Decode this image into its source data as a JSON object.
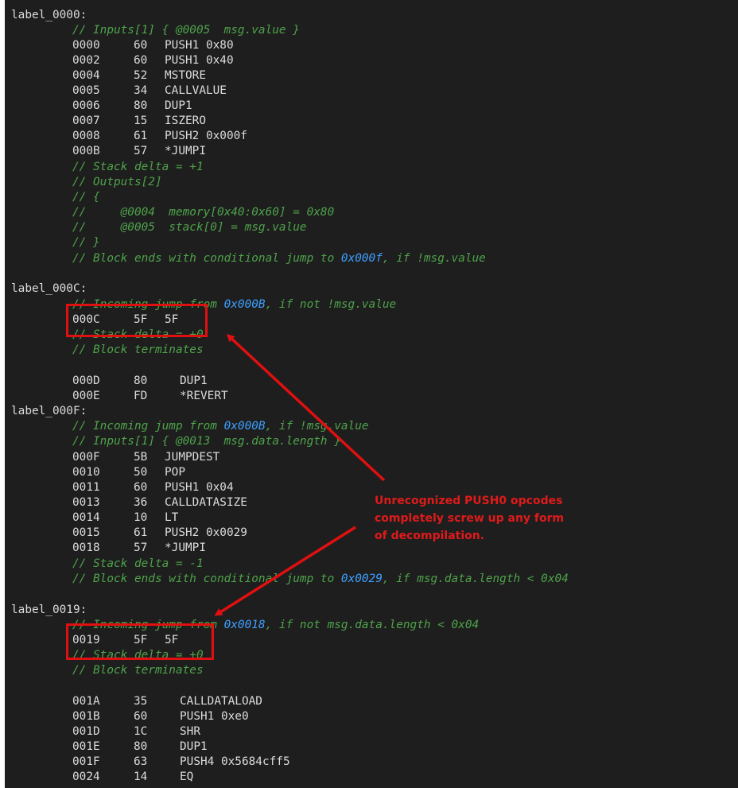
{
  "blocks": [
    {
      "label": "label_0000:",
      "pre_comments": [
        "// Inputs[1] { @0005  msg.value }"
      ],
      "instructions": [
        {
          "addr": "0000",
          "op": "60",
          "mnemonic": "PUSH1 0x80"
        },
        {
          "addr": "0002",
          "op": "60",
          "mnemonic": "PUSH1 0x40"
        },
        {
          "addr": "0004",
          "op": "52",
          "mnemonic": "MSTORE"
        },
        {
          "addr": "0005",
          "op": "34",
          "mnemonic": "CALLVALUE"
        },
        {
          "addr": "0006",
          "op": "80",
          "mnemonic": "DUP1"
        },
        {
          "addr": "0007",
          "op": "15",
          "mnemonic": "ISZERO"
        },
        {
          "addr": "0008",
          "op": "61",
          "mnemonic": "PUSH2 0x000f"
        },
        {
          "addr": "000B",
          "op": "57",
          "mnemonic": "*JUMPI"
        }
      ],
      "post_comments": [
        "// Stack delta = +1",
        "// Outputs[2]",
        "// {",
        "//     @0004  memory[0x40:0x60] = 0x80",
        "//     @0005  stack[0] = msg.value",
        "// }"
      ],
      "end_comment": {
        "pre": "// Block ends with conditional jump to ",
        "hex": "0x000f",
        "post": ", if !msg.value"
      }
    },
    {
      "label": "label_000C:",
      "incoming": {
        "pre": "// Incoming jump from ",
        "hex": "0x000B",
        "post": ", if not !msg.value"
      },
      "raw": {
        "addr": "000C",
        "op": "5F",
        "mnemonic": "5F"
      },
      "comments": [
        "// Stack delta = +0",
        "// Block terminates"
      ],
      "instructions": [
        {
          "addr": "000D",
          "op": "80",
          "mnemonic": "DUP1"
        },
        {
          "addr": "000E",
          "op": "FD",
          "mnemonic": "*REVERT"
        }
      ]
    },
    {
      "label": "label_000F:",
      "incoming": {
        "pre": "// Incoming jump from ",
        "hex": "0x000B",
        "post": ", if !msg.value"
      },
      "pre_comments": [
        "// Inputs[1] { @0013  msg.data.length }"
      ],
      "instructions": [
        {
          "addr": "000F",
          "op": "5B",
          "mnemonic": "JUMPDEST"
        },
        {
          "addr": "0010",
          "op": "50",
          "mnemonic": "POP"
        },
        {
          "addr": "0011",
          "op": "60",
          "mnemonic": "PUSH1 0x04"
        },
        {
          "addr": "0013",
          "op": "36",
          "mnemonic": "CALLDATASIZE"
        },
        {
          "addr": "0014",
          "op": "10",
          "mnemonic": "LT"
        },
        {
          "addr": "0015",
          "op": "61",
          "mnemonic": "PUSH2 0x0029"
        },
        {
          "addr": "0018",
          "op": "57",
          "mnemonic": "*JUMPI"
        }
      ],
      "post_comments": [
        "// Stack delta = -1"
      ],
      "end_comment": {
        "pre": "// Block ends with conditional jump to ",
        "hex": "0x0029",
        "post": ", if msg.data.length < 0x04"
      }
    },
    {
      "label": "label_0019:",
      "incoming": {
        "pre": "// Incoming jump from ",
        "hex": "0x0018",
        "post": ", if not msg.data.length < 0x04"
      },
      "raw": {
        "addr": "0019",
        "op": "5F",
        "mnemonic": "5F"
      },
      "comments": [
        "// Stack delta = +0",
        "// Block terminates"
      ],
      "instructions": [
        {
          "addr": "001A",
          "op": "35",
          "mnemonic": "CALLDATALOAD"
        },
        {
          "addr": "001B",
          "op": "60",
          "mnemonic": "PUSH1 0xe0"
        },
        {
          "addr": "001D",
          "op": "1C",
          "mnemonic": "SHR"
        },
        {
          "addr": "001E",
          "op": "80",
          "mnemonic": "DUP1"
        },
        {
          "addr": "001F",
          "op": "63",
          "mnemonic": "PUSH4 0x5684cff5"
        },
        {
          "addr": "0024",
          "op": "14",
          "mnemonic": "EQ"
        }
      ]
    }
  ],
  "annotation": {
    "lines": [
      "Unrecognized PUSH0 opcodes",
      "completely screw up any form",
      "of decompilation."
    ],
    "color": "#e01a1a"
  },
  "colors": {
    "background": "#1e1e1e",
    "text": "#dcdcdc",
    "comment": "#4ea34a",
    "hex": "#3ea0ff",
    "highlight": "#e01010"
  }
}
